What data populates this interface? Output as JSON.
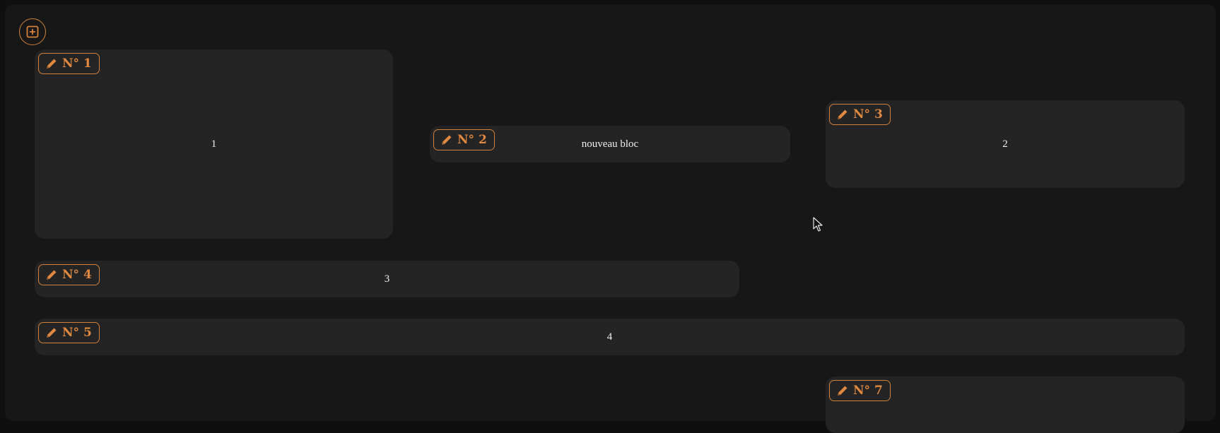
{
  "toolbar": {
    "add_icon": "plus-square-icon"
  },
  "blocks": [
    {
      "tag": "N° 1",
      "content": "1"
    },
    {
      "tag": "N° 2",
      "content": "nouveau bloc"
    },
    {
      "tag": "N° 3",
      "content": "2"
    },
    {
      "tag": "N° 4",
      "content": "3"
    },
    {
      "tag": "N° 5",
      "content": "4"
    },
    {
      "tag": "N° 7",
      "content": ""
    }
  ],
  "colors": {
    "accent": "#d3803a",
    "block_bg": "#242424",
    "canvas_bg": "#171717"
  },
  "icons": {
    "edit": "pencil-icon"
  }
}
